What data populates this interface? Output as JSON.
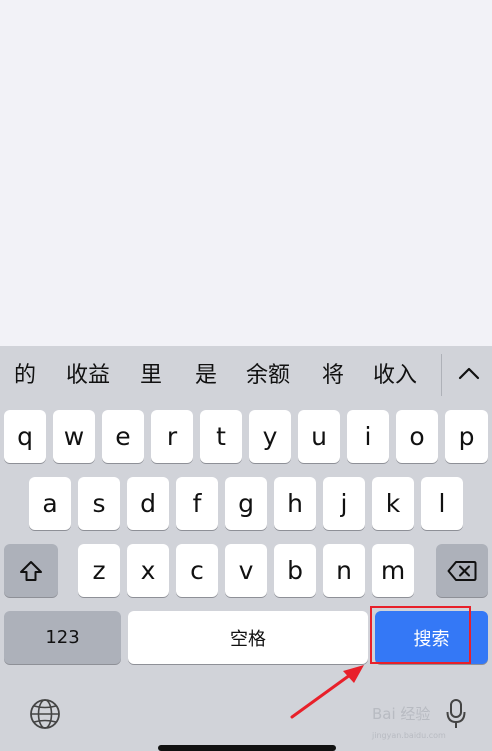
{
  "candidates": [
    "的",
    "收益",
    "里",
    "是",
    "余额",
    "将",
    "收入"
  ],
  "rows": {
    "row1": [
      "q",
      "w",
      "e",
      "r",
      "t",
      "y",
      "u",
      "i",
      "o",
      "p"
    ],
    "row2": [
      "a",
      "s",
      "d",
      "f",
      "g",
      "h",
      "j",
      "k",
      "l"
    ],
    "row3": [
      "z",
      "x",
      "c",
      "v",
      "b",
      "n",
      "m"
    ]
  },
  "bottom": {
    "numbers_label": "123",
    "space_label": "空格",
    "search_label": "搜索"
  },
  "watermark": {
    "text": "Bai 经验",
    "sub": "jingyan.baidu.com"
  },
  "colors": {
    "keyboard_bg": "#d1d3d9",
    "search_key": "#3478f6",
    "annotation": "#e8202a"
  },
  "icons": [
    "chevron-up-icon",
    "shift-icon",
    "delete-icon",
    "globe-icon",
    "mic-icon"
  ]
}
